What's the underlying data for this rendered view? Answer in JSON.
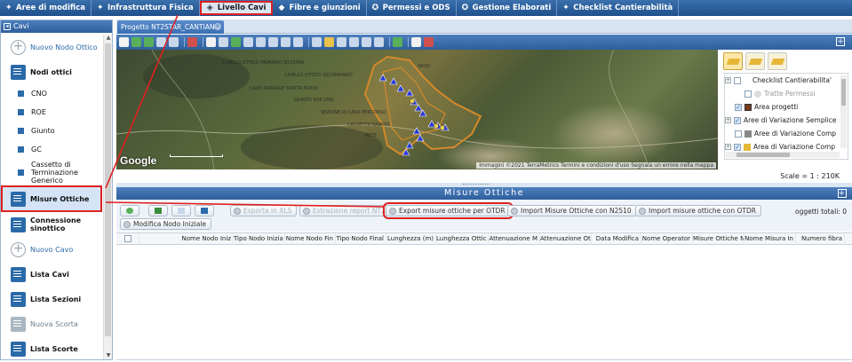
{
  "nav": {
    "items": [
      {
        "label": "Aree di modifica",
        "icon": "puzzle-icon"
      },
      {
        "label": "Infrastruttura Fisica",
        "icon": "puzzle-icon"
      },
      {
        "label": "Livello Cavi",
        "icon": "layers-icon",
        "active": true
      },
      {
        "label": "Fibre e giunzioni",
        "icon": "cable-icon"
      },
      {
        "label": "Permessi e ODS",
        "icon": "gear-icon"
      },
      {
        "label": "Gestione Elaborati",
        "icon": "gear-icon"
      },
      {
        "label": "Checklist Cantierabilità",
        "icon": "puzzle-icon"
      }
    ]
  },
  "left": {
    "header": "Cavi",
    "items": [
      {
        "label": "Nuovo Nodo Ottico",
        "type": "plus"
      },
      {
        "label": "Nodi ottici",
        "type": "doc"
      },
      {
        "label": "CNO",
        "type": "sub"
      },
      {
        "label": "ROE",
        "type": "sub"
      },
      {
        "label": "Giunto",
        "type": "sub"
      },
      {
        "label": "GC",
        "type": "sub"
      },
      {
        "label": "Cassetto di Terminazione Generico",
        "type": "sub"
      },
      {
        "label": "Misure Ottiche",
        "type": "doc",
        "selected": true
      },
      {
        "label": "Connessione sinottico",
        "type": "doc"
      },
      {
        "label": "Nuovo Cavo",
        "type": "plus"
      },
      {
        "label": "Lista Cavi",
        "type": "doc"
      },
      {
        "label": "Lista Sezioni",
        "type": "doc"
      },
      {
        "label": "Nuova Scorta",
        "type": "plusgray"
      },
      {
        "label": "Lista Scorte",
        "type": "doc"
      }
    ]
  },
  "project_tab": "Progetto NT2STAR_CANTIANO",
  "map": {
    "google": "Google",
    "attribution": "Immagini ©2021 TerraMetrics   Termini e condizioni d'uso   Segnala un errore nella mappa"
  },
  "layers": {
    "rows": [
      {
        "label": "Checklist Cantierabilita'",
        "pm": "+",
        "checked": false
      },
      {
        "label": "Tratte Permessi",
        "pm": "",
        "checked": false,
        "gray": true
      },
      {
        "label": "Area progetti",
        "pm": "",
        "checked": true,
        "swatch": "#7a3b1a"
      },
      {
        "label": "Aree di Variazione Semplice",
        "pm": "+",
        "checked": true
      },
      {
        "label": "Aree di Variazione Comp",
        "pm": "",
        "checked": false,
        "swatch": "#888888"
      },
      {
        "label": "Area di Variazione Comp",
        "pm": "+",
        "checked": true,
        "swatch": "#e6b638"
      }
    ],
    "scale": "Scale = 1 : 210K"
  },
  "misure": {
    "title": "Misure Ottiche",
    "buttons": {
      "export_xls": "Esporta in XLS",
      "estrazione": "Estrazione report NT2",
      "export_otdr": "Export misure ottiche per OTDR",
      "import_n2510": "Import Misure Ottiche con N2510",
      "import_otdr": "Import misure ottiche con OTDR",
      "modifica_nodo": "Modifica Nodo Iniziale"
    },
    "totals": "oggetti totali: 0",
    "columns": [
      "Nome Nodo Iniz",
      "Tipo Nodo Inizia",
      "Nome Nodo Fin",
      "Tipo Nodo Final",
      "Lunghezza (m)",
      "Lunghezza Ottic",
      "Attenuazione M",
      "Attenuazione Ot",
      "Data Modifica",
      "Nome Operator",
      "Misure Ottiche N",
      "Nome Misura In",
      "Numero fibra"
    ]
  },
  "colors": {
    "accent": "#2f5f9c",
    "highlight": "#e0201f"
  }
}
